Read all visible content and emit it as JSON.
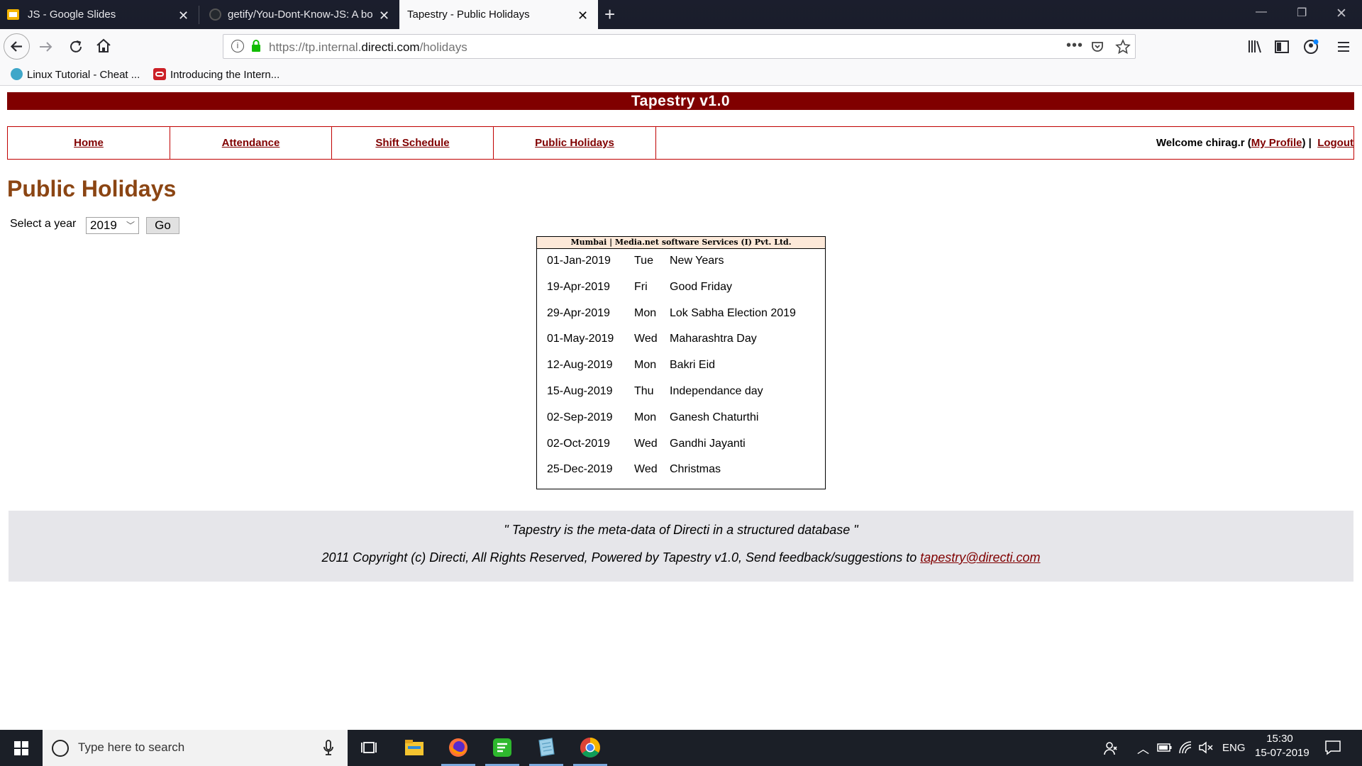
{
  "browser": {
    "tabs": [
      {
        "title": "JS - Google Slides",
        "favicon_color": "#f4b400",
        "active": false
      },
      {
        "title": "getify/You-Dont-Know-JS: A bo",
        "favicon_color": "#24292e",
        "active": false
      },
      {
        "title": "Tapestry - Public Holidays",
        "favicon_color": "",
        "active": true
      }
    ],
    "url": {
      "prefix": "https://tp.internal.",
      "host": "directi.com",
      "path": "/holidays"
    },
    "bookmarks": [
      {
        "label": "Linux Tutorial - Cheat ...",
        "icon_color": "#3fa7c9"
      },
      {
        "label": "Introducing the Intern...",
        "icon_color": "#cc2027"
      }
    ]
  },
  "app": {
    "banner_title": "Tapestry v1.0",
    "menu": [
      {
        "label": "Home"
      },
      {
        "label": "Attendance"
      },
      {
        "label": "Shift Schedule"
      },
      {
        "label": "Public Holidays"
      }
    ],
    "welcome_prefix": "Welcome chirag.r (",
    "my_profile": "My Profile",
    "welcome_suffix": ") | ",
    "logout": "Logout",
    "colors": {
      "brand": "#800000",
      "title": "#8b4513",
      "table_header_bg": "#fde9d9"
    }
  },
  "holidays": {
    "page_title": "Public Holidays",
    "year_label": "Select a year",
    "selected_year": "2019",
    "go_label": "Go",
    "table_title": "Mumbai | Media.net software Services (I) Pvt. Ltd.",
    "rows": [
      {
        "date": "01-Jan-2019",
        "day": "Tue",
        "name": "New Years"
      },
      {
        "date": "19-Apr-2019",
        "day": "Fri",
        "name": "Good Friday"
      },
      {
        "date": "29-Apr-2019",
        "day": "Mon",
        "name": "Lok Sabha Election 2019"
      },
      {
        "date": "01-May-2019",
        "day": "Wed",
        "name": "Maharashtra Day"
      },
      {
        "date": "12-Aug-2019",
        "day": "Mon",
        "name": "Bakri Eid"
      },
      {
        "date": "15-Aug-2019",
        "day": "Thu",
        "name": "Independance day"
      },
      {
        "date": "02-Sep-2019",
        "day": "Mon",
        "name": "Ganesh Chaturthi"
      },
      {
        "date": "02-Oct-2019",
        "day": "Wed",
        "name": "Gandhi Jayanti"
      },
      {
        "date": "25-Dec-2019",
        "day": "Wed",
        "name": "Christmas"
      }
    ]
  },
  "footer": {
    "tagline": "\" Tapestry is the meta-data of Directi in a structured database \"",
    "copyright": "2011 Copyright (c) Directi, All Rights Reserved, Powered by Tapestry v1.0, Send feedback/suggestions to ",
    "email": "tapestry@directi.com"
  },
  "taskbar": {
    "search_placeholder": "Type here to search",
    "language": "ENG",
    "time": "15:30",
    "date": "15-07-2019"
  }
}
